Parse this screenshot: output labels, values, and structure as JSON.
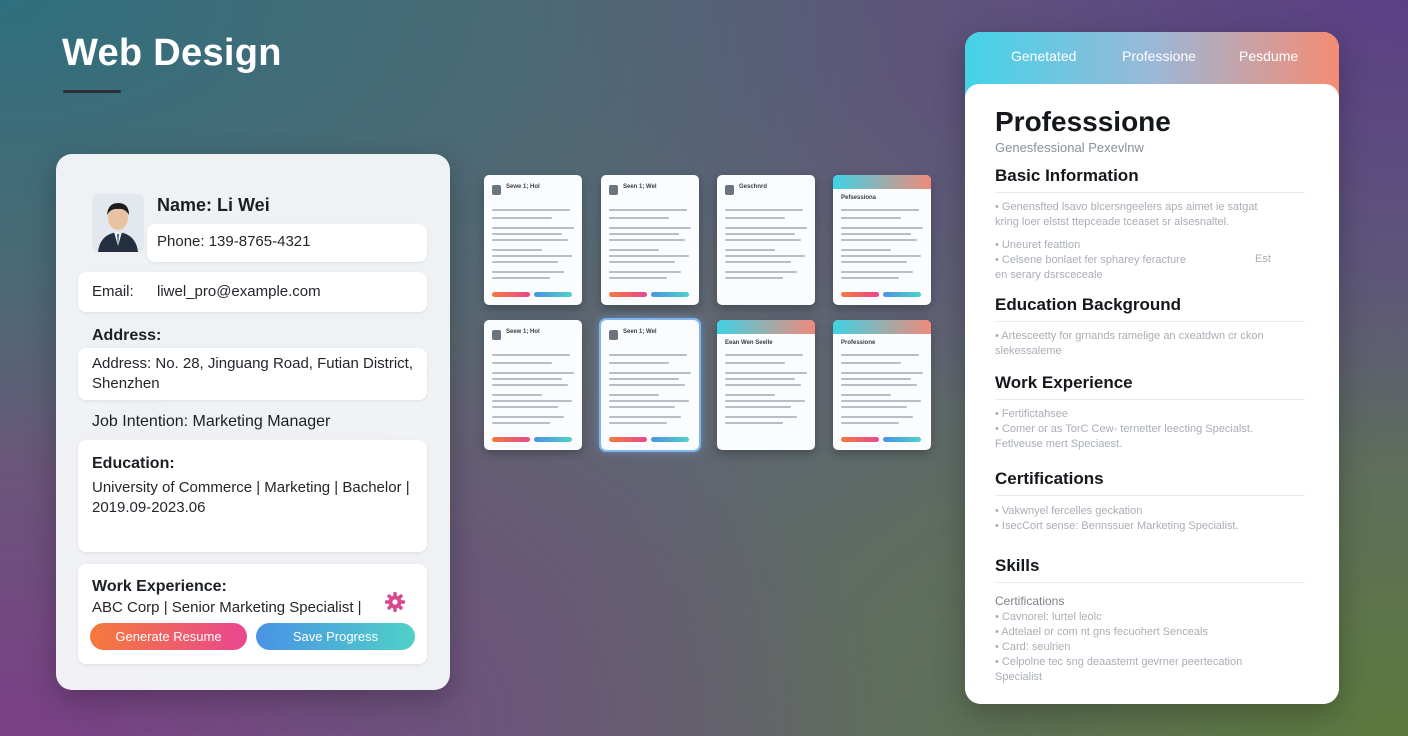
{
  "header": {
    "title": "Web Design"
  },
  "form": {
    "name": "Name: Li Wei",
    "phone": "Phone: 139-8765-4321",
    "email_label": "Email:",
    "email_value": "liwel_pro@example.com",
    "address_label": "Address:",
    "address_value": "Address: No. 28, Jinguang Road, Futian District, Shenzhen",
    "job_intention": "Job Intention: Marketing Manager",
    "education_label": "Education:",
    "education_value": "University of Commerce | Marketing | Bachelor | 2019.09-2023.06",
    "work_label": "Work Experience:",
    "work_value": "ABC Corp | Senior Marketing Specialist |",
    "generate_button": "Generate Resume",
    "save_button": "Save Progress",
    "gear_icon": "gear-icon"
  },
  "templates": {
    "items": [
      {
        "style": "plain",
        "name": "Sewe 1; Hol"
      },
      {
        "style": "plain",
        "name": "Seen 1; Wel"
      },
      {
        "style": "columns",
        "name": "Geschnrd"
      },
      {
        "style": "header",
        "name": "Pefsessiona"
      },
      {
        "style": "plain",
        "name": "Seew 1; Hol"
      },
      {
        "style": "plain-selected",
        "name": "Seen 1; Wel"
      },
      {
        "style": "form",
        "name": "Eean Wen Seelle"
      },
      {
        "style": "header",
        "name": "Professione"
      }
    ]
  },
  "preview": {
    "tabs": [
      "Genetated",
      "Professione",
      "Pesdume"
    ],
    "title": "Professsione",
    "subtitle": "Genesfessional Pexevlnw",
    "sections": {
      "basic": "Basic Information",
      "education": "Education Background",
      "work": "Work Experience",
      "certifications": "Certifications",
      "skills": "Skills"
    },
    "basic_lines": [
      "• Genensfted lsavo blcersngeelers aps aimet ie satgat",
      "kring loer elstst ttepceade tceaset sr alsesnaltel.",
      "• Uneuret feattion",
      "• Celsene bonlaet fer spharey feracture",
      "en serary dsrsceceale"
    ],
    "basic_side": "Est",
    "education_lines": [
      "• Artesceetty for grnands ramelige an cxeatdwn cr ckon",
      "slekessaleme"
    ],
    "work_lines": [
      "• Fertifictahsee",
      "• Comer or as TorC Cew- ternetter leecting Specialst.",
      "Fetlveuse mert Speciaest."
    ],
    "cert_lines": [
      "• Vakwnyel fercelles geckation",
      "• IsecCort sense: Bennssuer Marketing Specialist."
    ],
    "skills_sub": "Certifications",
    "skills_lines": [
      "• Cavnorel: lurtel leolc",
      "• Adtelael or com nt gns fecuohert Senceals",
      "• Card: seulrien",
      "• Celpolne tec sng deaastemt gevrner peertecation",
      "Specialist"
    ]
  }
}
